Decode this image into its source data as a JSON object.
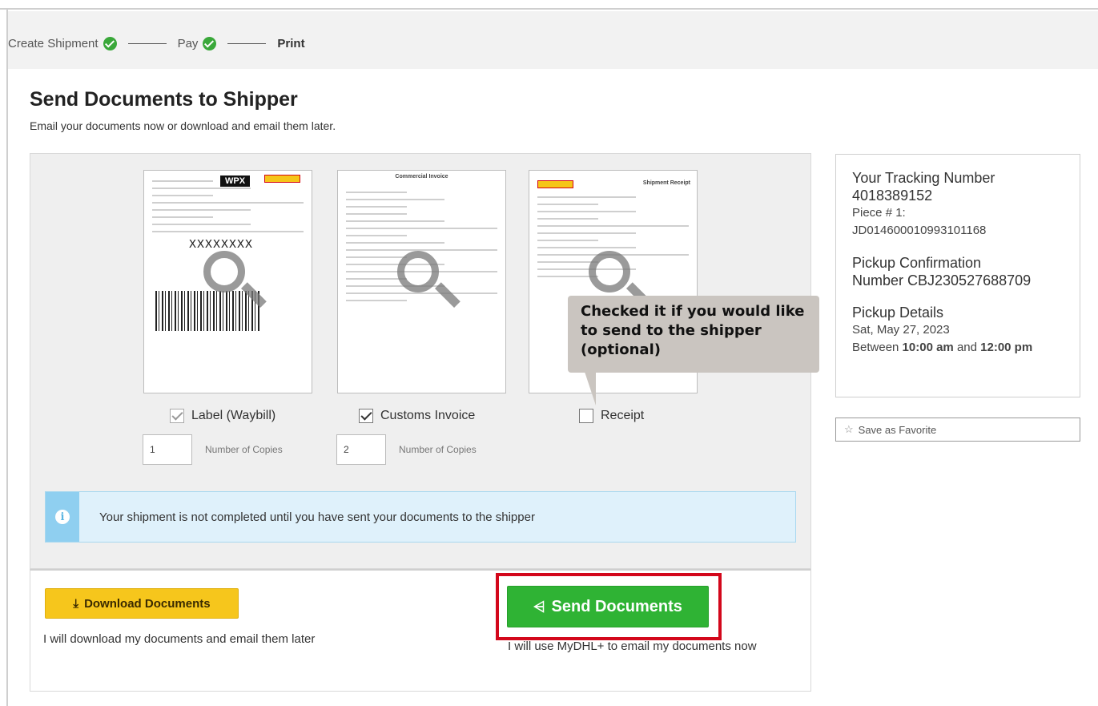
{
  "stepper": {
    "steps": [
      {
        "label": "Create Shipment",
        "done": true
      },
      {
        "label": "Pay",
        "done": true
      },
      {
        "label": "Print",
        "done": false
      }
    ]
  },
  "page": {
    "title": "Send Documents to Shipper",
    "subtitle": "Email your documents now or download and email them later."
  },
  "documents": [
    {
      "label": "Label (Waybill)",
      "checked": true,
      "disabled": true,
      "copies": "1",
      "copies_label": "Number of Copies",
      "thumb_text": "XXXXXXXX",
      "thumb_badge": "WPX"
    },
    {
      "label": "Customs Invoice",
      "checked": true,
      "disabled": false,
      "copies": "2",
      "copies_label": "Number of Copies",
      "thumb_heading": "Commercial Invoice"
    },
    {
      "label": "Receipt",
      "checked": false,
      "disabled": false,
      "thumb_heading": "Shipment Receipt"
    }
  ],
  "info_bar": {
    "icon": "info-icon",
    "text": "Your shipment is not completed until you have sent your documents to the shipper"
  },
  "callout": {
    "text": "Checked it if you would like to send to the shipper (optional)"
  },
  "actions": {
    "download_label": "Download Documents",
    "download_note": "I will download my documents and email them later",
    "send_label": "Send Documents",
    "send_note": "I will use MyDHL+ to email my documents now"
  },
  "tracking": {
    "title": "Your Tracking Number",
    "number": "4018389152",
    "piece_label": "Piece # 1:",
    "piece_id": "JD014600010993101168",
    "pickup_title": "Pickup Confirmation",
    "pickup_number": "Number CBJ230527688709",
    "details_title": "Pickup Details",
    "details_date": "Sat, May 27, 2023",
    "details_between": "Between",
    "details_from": "10:00 am",
    "details_and": "and",
    "details_to": "12:00 pm"
  },
  "favorite": {
    "label": "Save as Favorite",
    "icon": "star-icon"
  },
  "colors": {
    "download_button": "#f6c61c",
    "send_button": "#2fb334",
    "highlight": "#d3071b",
    "info_bg": "#dff1fb",
    "check_green": "#3aa83a"
  }
}
